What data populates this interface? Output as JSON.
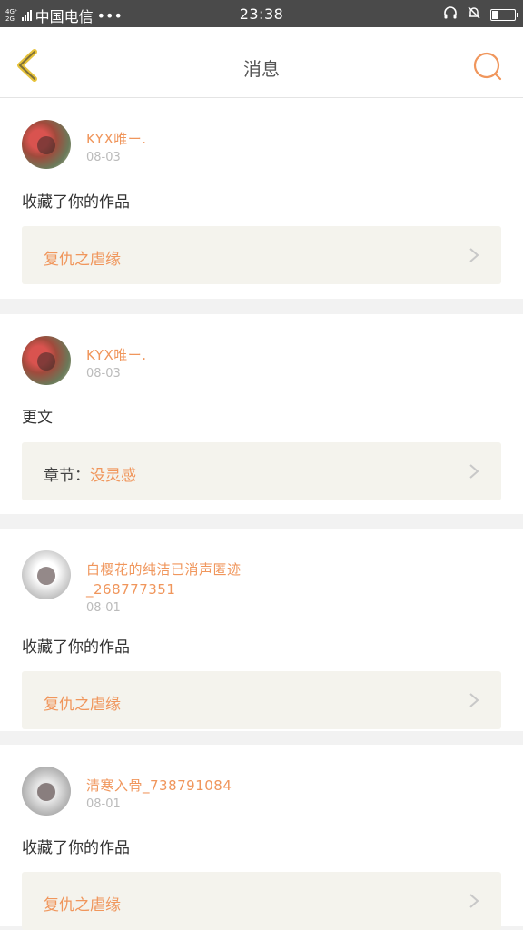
{
  "status_bar": {
    "network": "4G⁺ 4G⁺\n2G",
    "carrier": "中国电信",
    "dots": "•••",
    "time": "23:38",
    "battery_level": 0.3
  },
  "header": {
    "back_icon": "chevron-left-icon",
    "title": "消息",
    "search_icon": "search-icon",
    "accent_color": "#f0965c"
  },
  "messages": [
    {
      "username": "KYX唯ー.",
      "date": "08-03",
      "action": "收藏了你的作品",
      "work_prefix": "",
      "work_title": "复仇之虐缘"
    },
    {
      "username": "KYX唯ー.",
      "date": "08-03",
      "action": "更文",
      "work_prefix": "章节：",
      "work_title": "没灵感"
    },
    {
      "username": "白樱花的纯洁已消声匿迹_268777351",
      "date": "08-01",
      "action": "收藏了你的作品",
      "work_prefix": "",
      "work_title": "复仇之虐缘"
    },
    {
      "username": "清寒入骨_738791084",
      "date": "08-01",
      "action": "收藏了你的作品",
      "work_prefix": "",
      "work_title": "复仇之虐缘"
    }
  ]
}
